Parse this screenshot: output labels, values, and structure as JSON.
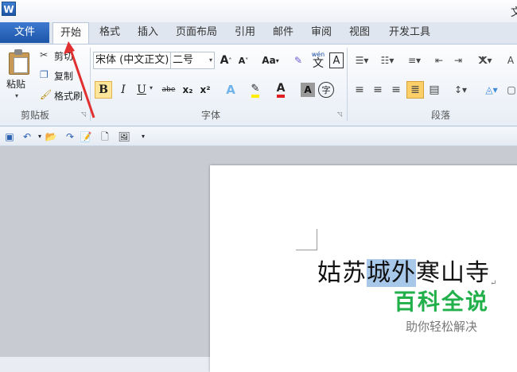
{
  "window": {
    "title": "文",
    "app_icon_letter": "W"
  },
  "tabs": [
    {
      "label": "文件"
    },
    {
      "label": "开始"
    },
    {
      "label": "格式"
    },
    {
      "label": "插入"
    },
    {
      "label": "页面布局"
    },
    {
      "label": "引用"
    },
    {
      "label": "邮件"
    },
    {
      "label": "审阅"
    },
    {
      "label": "视图"
    },
    {
      "label": "开发工具"
    }
  ],
  "clipboard": {
    "group_label": "剪贴板",
    "paste_label": "粘贴",
    "cut_label": "剪切",
    "copy_label": "复制",
    "format_painter_label": "格式刷"
  },
  "font": {
    "group_label": "字体",
    "font_name": "宋体 (中文正文)",
    "font_size": "二号",
    "case_label": "Aa",
    "clear_format_label": "A",
    "phonetic_label": "wén",
    "phonetic_char": "文",
    "border_char": "A",
    "bold": "B",
    "italic": "I",
    "underline": "U",
    "strike": "abe",
    "subscript": "x₂",
    "superscript": "x²",
    "enclose_char": "字"
  },
  "paragraph": {
    "group_label": "段落"
  },
  "document": {
    "text_before": "姑苏",
    "text_selected": "城外",
    "text_after": "寒山寺",
    "paragraph_mark": "↵"
  },
  "watermark": {
    "title": "百科全说",
    "subtitle": "助你轻松解决"
  },
  "colors": {
    "file_tab": "#2b66bb",
    "watermark_green": "#22b04b",
    "selection": "#a8c8ea",
    "arrow": "#e03030"
  }
}
